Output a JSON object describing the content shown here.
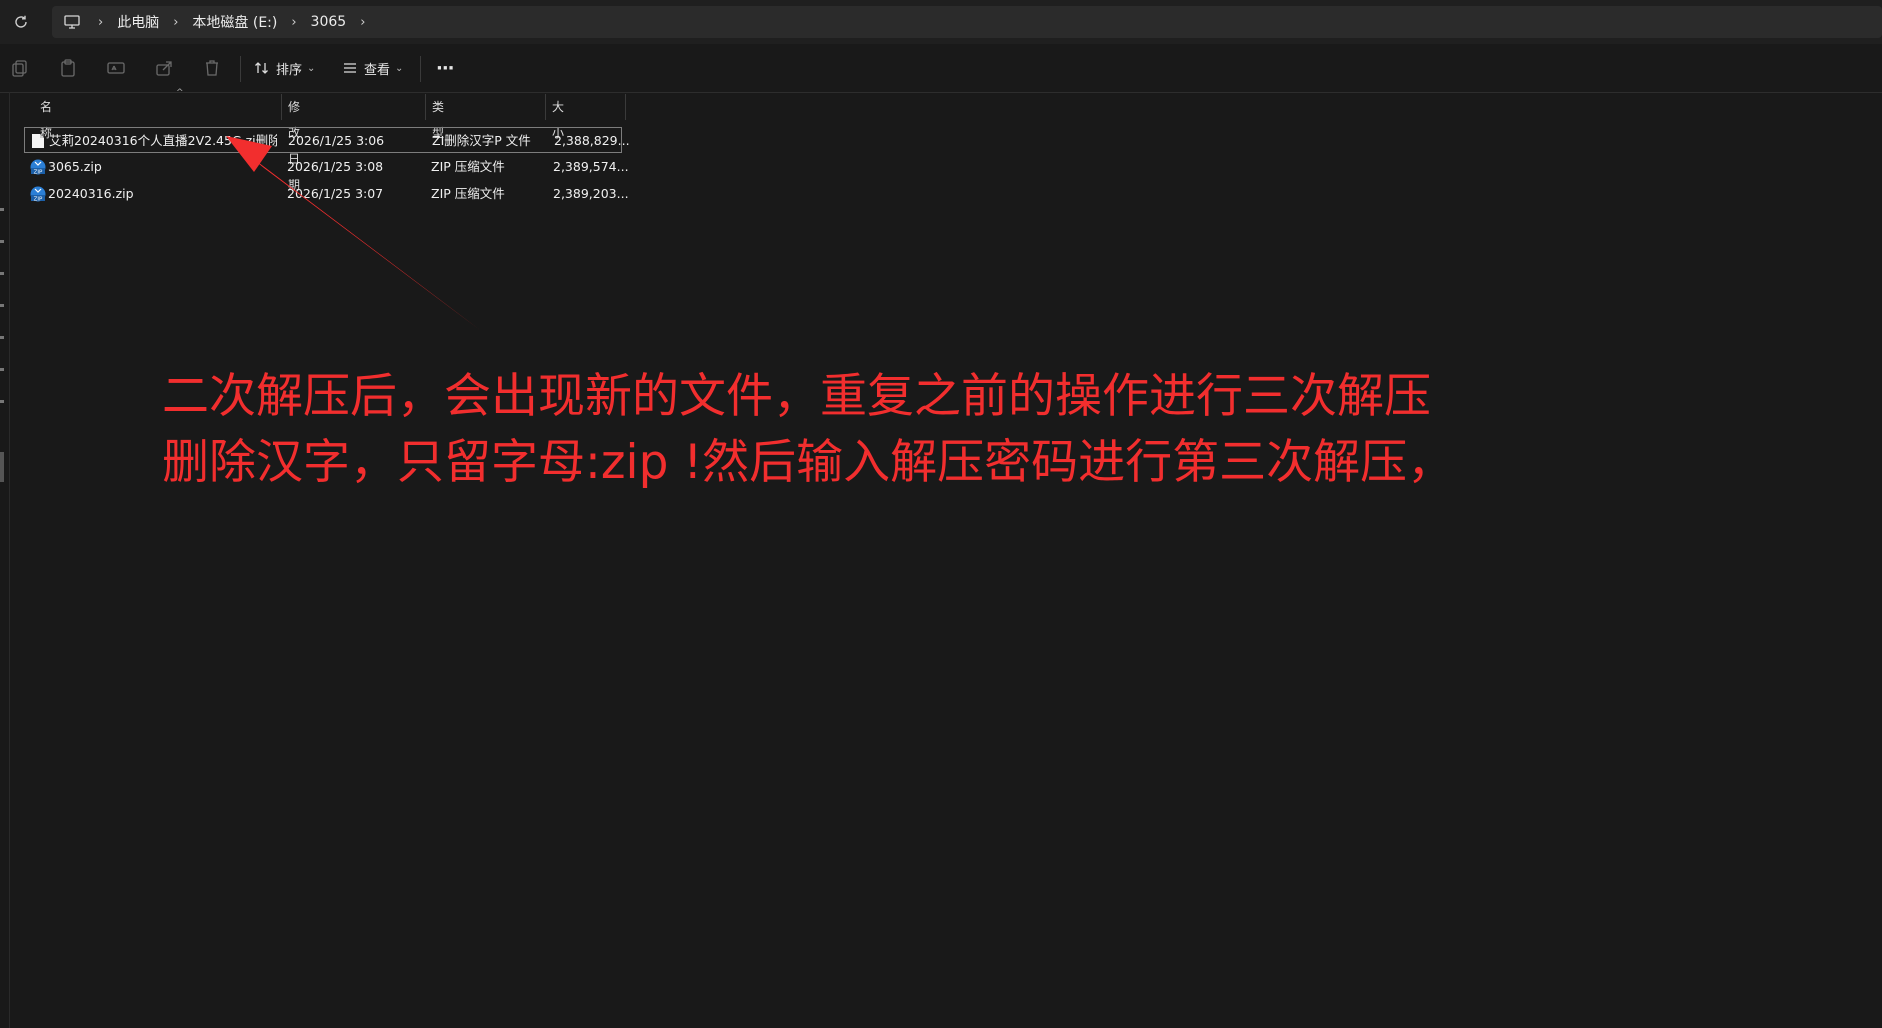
{
  "breadcrumb": {
    "items": [
      "此电脑",
      "本地磁盘 (E:)",
      "3065"
    ]
  },
  "toolbar": {
    "sort_label": "排序",
    "view_label": "查看",
    "more_label": "···"
  },
  "columns": {
    "name": "名称",
    "date": "修改日期",
    "type": "类型",
    "size": "大小"
  },
  "files": [
    {
      "name": "艾莉20240316个人直播2V2.45G.zi删除...",
      "date": "2026/1/25 3:06",
      "type": "ZI删除汉字P 文件",
      "size": "2,388,829...",
      "icon": "generic-file-icon"
    },
    {
      "name": "3065.zip",
      "date": "2026/1/25 3:08",
      "type": "ZIP 压缩文件",
      "size": "2,389,574...",
      "icon": "zip-file-icon"
    },
    {
      "name": "20240316.zip",
      "date": "2026/1/25 3:07",
      "type": "ZIP 压缩文件",
      "size": "2,389,203...",
      "icon": "zip-file-icon"
    }
  ],
  "annotation": {
    "line1": "二次解压后，会出现新的文件，重复之前的操作进行三次解压",
    "line2": "删除汉字，只留字母:zip !然后输入解压密码进行第三次解压，",
    "color": "#f22e2e"
  }
}
